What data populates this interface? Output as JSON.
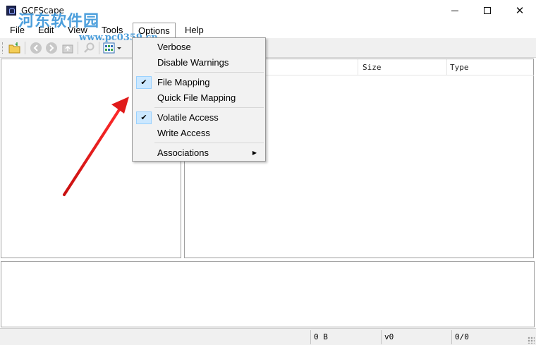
{
  "window": {
    "title": "GCFScape",
    "watermark_text": "河东软件园",
    "watermark_url": "www.pc0359.cn"
  },
  "menubar": {
    "file": "File",
    "edit": "Edit",
    "view": "View",
    "tools": "Tools",
    "options": "Options",
    "help": "Help"
  },
  "toolbar": {
    "icons": [
      "open-folder-icon",
      "back-icon",
      "forward-icon",
      "up-folder-icon",
      "find-icon",
      "view-mode-icon"
    ]
  },
  "list": {
    "columns": {
      "size": "Size",
      "type": "Type"
    }
  },
  "options_menu": {
    "verbose": "Verbose",
    "disable_warnings": "Disable Warnings",
    "file_mapping": "File Mapping",
    "quick_file_mapping": "Quick File Mapping",
    "volatile_access": "Volatile Access",
    "write_access": "Write Access",
    "associations": "Associations",
    "checked": [
      "File Mapping",
      "Volatile Access"
    ]
  },
  "statusbar": {
    "size": "0 B",
    "version": "v0",
    "count": "0/0"
  },
  "colors": {
    "arrow": "#e01a1a",
    "check_bg": "#cce8ff",
    "watermark": "#2f8fd6"
  }
}
